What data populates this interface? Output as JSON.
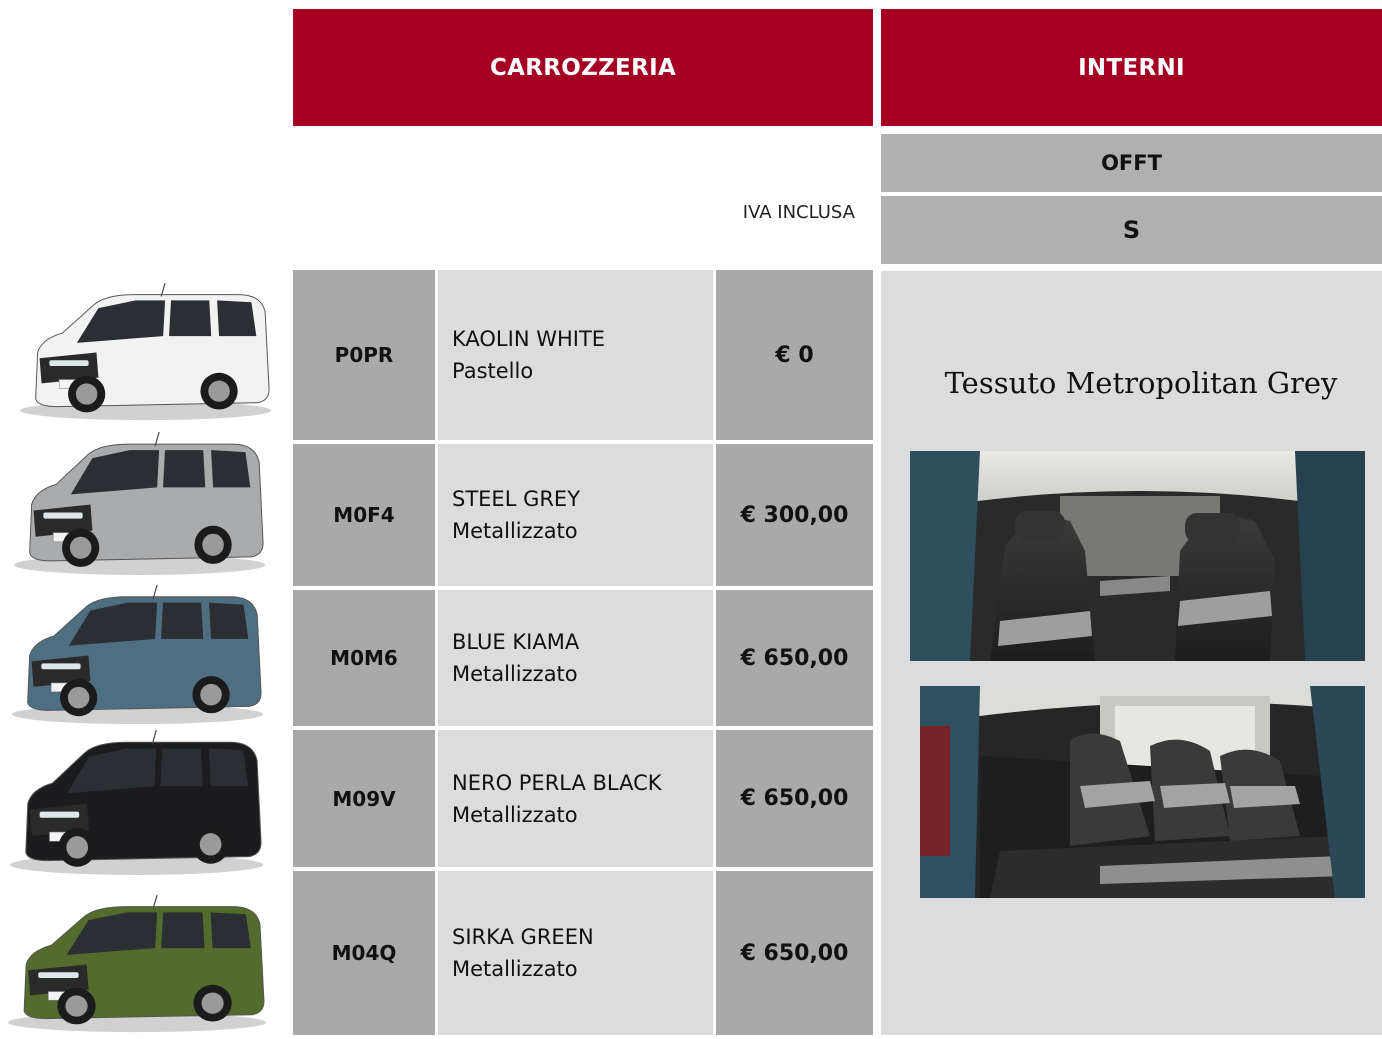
{
  "headers": {
    "carrozzeria": "CARROZZERIA",
    "interni": "INTERNI",
    "interior_code": "OFFT",
    "trim": "S",
    "iva": "IVA INCLUSA"
  },
  "colors": {
    "accent": "#a50021",
    "code_cell": "#a9a9a9",
    "name_cell": "#dcdcdc"
  },
  "rows": [
    {
      "code": "P0PR",
      "name": "KAOLIN WHITE",
      "finish": "Pastello",
      "price": "€ 0",
      "body_color": "#f2f2f2"
    },
    {
      "code": "M0F4",
      "name": "STEEL GREY",
      "finish": "Metallizzato",
      "price": "€ 300,00",
      "body_color": "#a9abad"
    },
    {
      "code": "M0M6",
      "name": "BLUE KIAMA",
      "finish": "Metallizzato",
      "price": "€ 650,00",
      "body_color": "#4e6e82"
    },
    {
      "code": "M09V",
      "name": "NERO PERLA BLACK",
      "finish": "Metallizzato",
      "price": "€ 650,00",
      "body_color": "#1c1c1e"
    },
    {
      "code": "M04Q",
      "name": "SIRKA GREEN",
      "finish": "Metallizzato",
      "price": "€ 650,00",
      "body_color": "#536b2c"
    }
  ],
  "interior": {
    "fabric": "Tessuto Metropolitan Grey"
  }
}
